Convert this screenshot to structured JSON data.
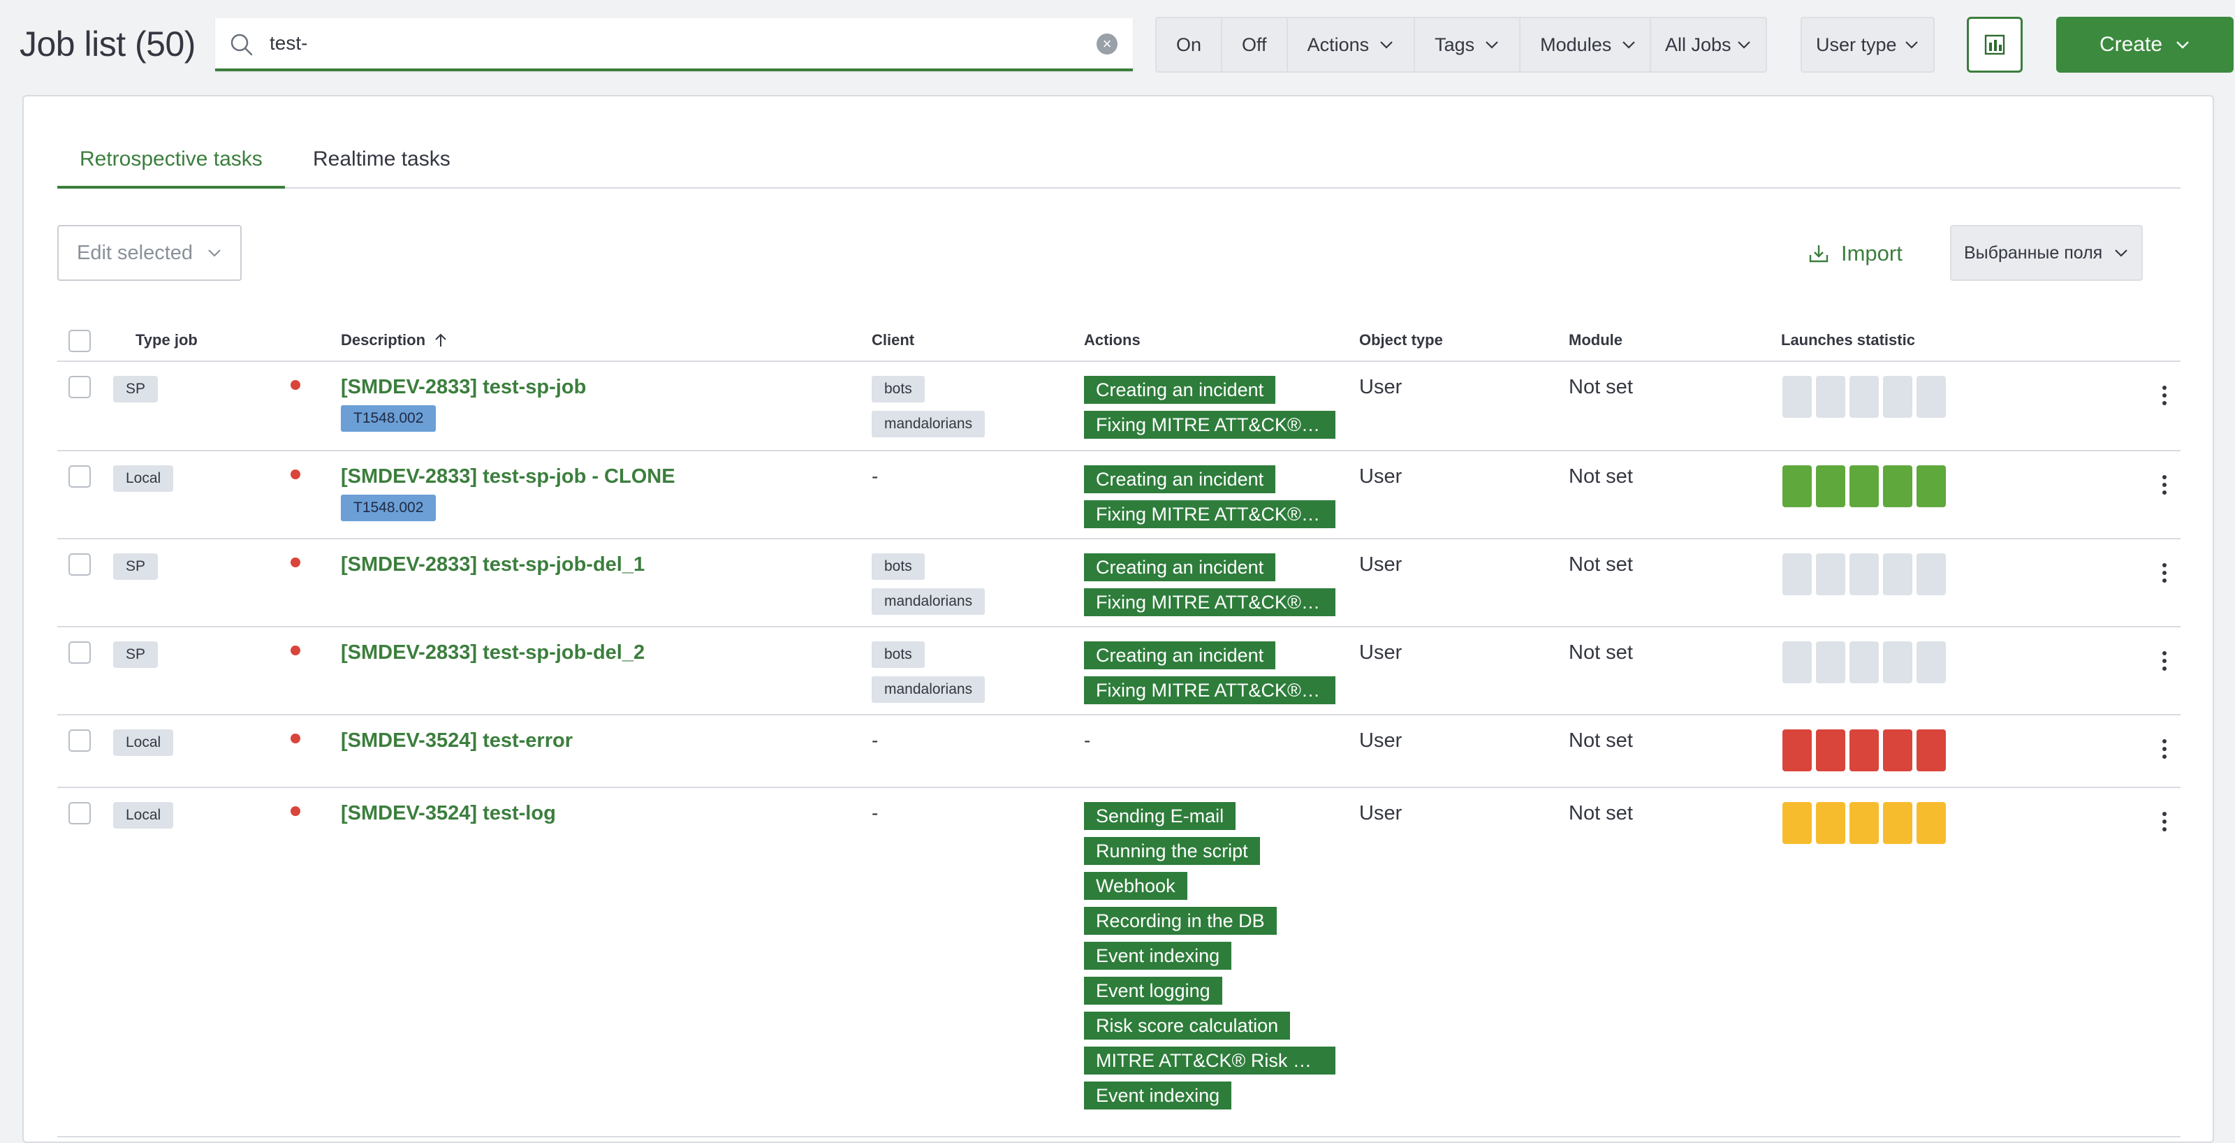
{
  "header": {
    "title": "Job list (50)",
    "search_value": "test-",
    "filter_on": "On",
    "filter_off": "Off",
    "filter_actions": "Actions",
    "filter_tags": "Tags",
    "filter_modules": "Modules",
    "all_jobs": "All Jobs",
    "user_type": "User type",
    "create": "Create"
  },
  "tabs": {
    "retrospective": "Retrospective tasks",
    "realtime": "Realtime tasks"
  },
  "toolbar": {
    "edit_selected": "Edit selected",
    "import": "Import",
    "selected_fields": "Выбранные поля"
  },
  "table": {
    "headers": {
      "type_job": "Type job",
      "description": "Description",
      "client": "Client",
      "actions": "Actions",
      "object_type": "Object type",
      "module": "Module",
      "launches": "Launches statistic"
    },
    "rows": [
      {
        "type": "SP",
        "description": "[SMDEV-2833] test-sp-job",
        "tag": "T1548.002",
        "clients": [
          "bots",
          "mandalorians"
        ],
        "client_dash": "",
        "actions": [
          "Creating an incident",
          "Fixing MITRE ATT&CK® tactics and techniques"
        ],
        "action_dash": "",
        "object_type": "User",
        "module": "Not set",
        "launch_color": "#dde1e8"
      },
      {
        "type": "Local",
        "description": "[SMDEV-2833] test-sp-job - CLONE",
        "tag": "T1548.002",
        "clients": [],
        "client_dash": "-",
        "actions": [
          "Creating an incident",
          "Fixing MITRE ATT&CK® tactics and techniques"
        ],
        "action_dash": "",
        "object_type": "User",
        "module": "Not set",
        "launch_color": "#5fa83c"
      },
      {
        "type": "SP",
        "description": "[SMDEV-2833] test-sp-job-del_1",
        "tag": "",
        "clients": [
          "bots",
          "mandalorians"
        ],
        "client_dash": "",
        "actions": [
          "Creating an incident",
          "Fixing MITRE ATT&CK® tactics and techniques"
        ],
        "action_dash": "",
        "object_type": "User",
        "module": "Not set",
        "launch_color": "#dde1e8"
      },
      {
        "type": "SP",
        "description": "[SMDEV-2833] test-sp-job-del_2",
        "tag": "",
        "clients": [
          "bots",
          "mandalorians"
        ],
        "client_dash": "",
        "actions": [
          "Creating an incident",
          "Fixing MITRE ATT&CK® tactics and techniques"
        ],
        "action_dash": "",
        "object_type": "User",
        "module": "Not set",
        "launch_color": "#dde1e8"
      },
      {
        "type": "Local",
        "description": "[SMDEV-3524] test-error",
        "tag": "",
        "clients": [],
        "client_dash": "-",
        "actions": [],
        "action_dash": "-",
        "object_type": "User",
        "module": "Not set",
        "launch_color": "#d9443b"
      },
      {
        "type": "Local",
        "description": "[SMDEV-3524] test-log",
        "tag": "",
        "clients": [],
        "client_dash": "-",
        "actions": [
          "Sending E-mail",
          "Running the script",
          "Webhook",
          "Recording in the DB",
          "Event indexing",
          "Event logging",
          "Risk score calculation",
          "MITRE ATT&CK® Risk Score calculation",
          "Event indexing"
        ],
        "action_dash": "",
        "object_type": "User",
        "module": "Not set",
        "launch_color": "#f7bc2d"
      }
    ]
  }
}
